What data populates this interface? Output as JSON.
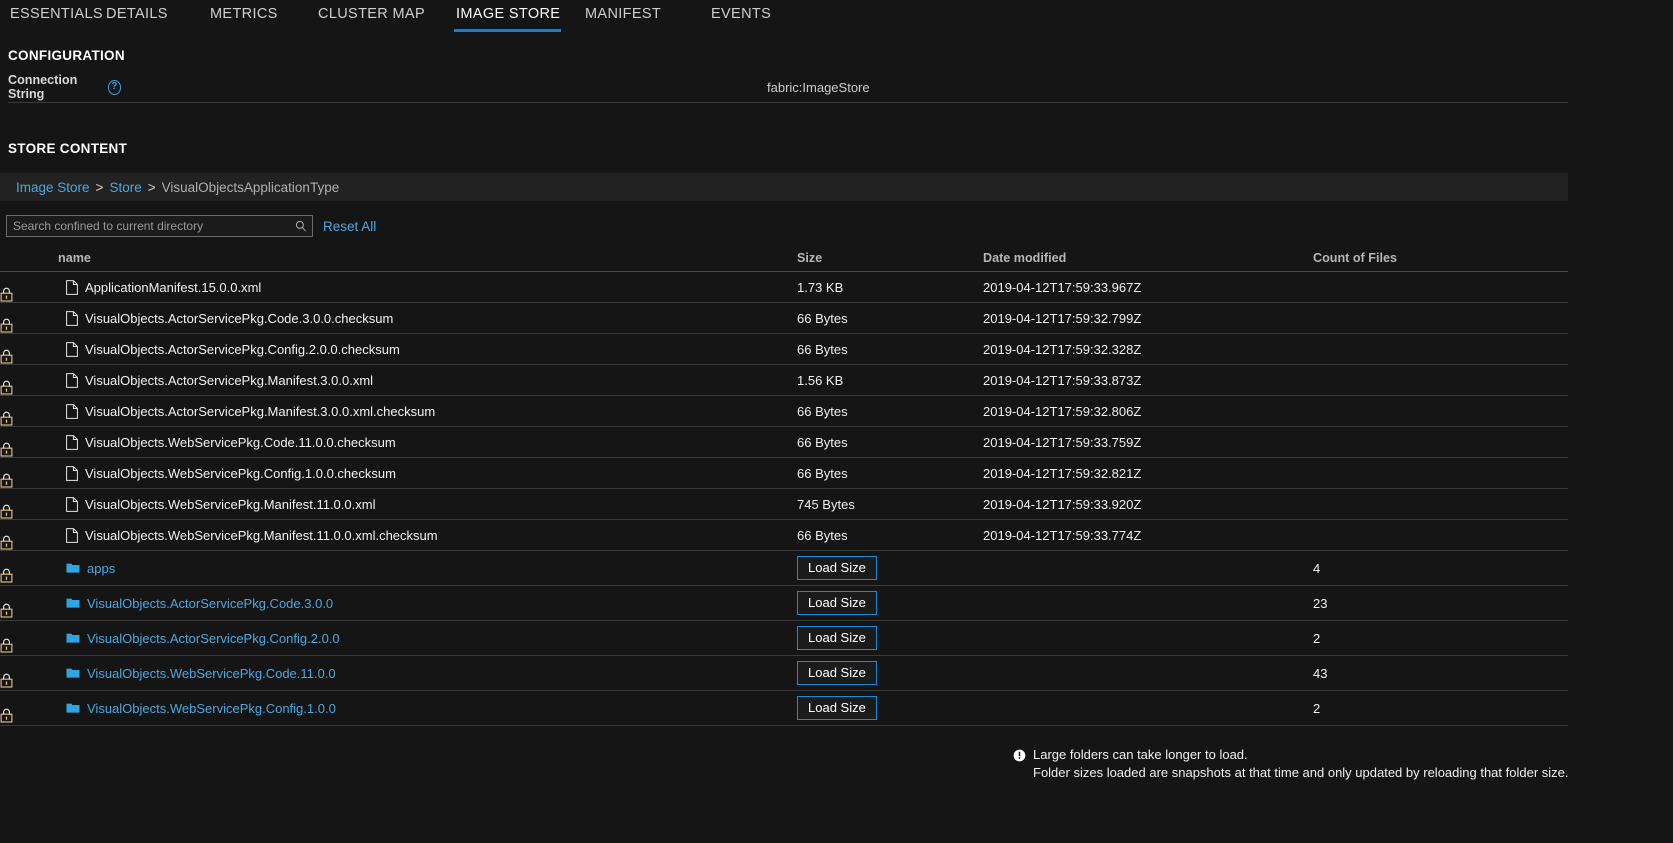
{
  "tabs": [
    {
      "label": "ESSENTIALS",
      "active": false
    },
    {
      "label": "DETAILS",
      "active": false
    },
    {
      "label": "METRICS",
      "active": false
    },
    {
      "label": "CLUSTER MAP",
      "active": false
    },
    {
      "label": "IMAGE STORE",
      "active": true
    },
    {
      "label": "MANIFEST",
      "active": false
    },
    {
      "label": "EVENTS",
      "active": false
    }
  ],
  "configuration": {
    "heading": "CONFIGURATION",
    "connection_string_label": "Connection String",
    "help_glyph": "?",
    "connection_string_value": "fabric:ImageStore"
  },
  "store_content": {
    "heading": "STORE CONTENT",
    "breadcrumb": [
      {
        "label": "Image Store",
        "link": true
      },
      {
        "label": ">",
        "link": false
      },
      {
        "label": "Store",
        "link": true
      },
      {
        "label": ">",
        "link": false
      },
      {
        "label": "VisualObjectsApplicationType",
        "link": false
      }
    ],
    "search_placeholder": "Search confined to current directory",
    "search_value": "",
    "reset_all_label": "Reset All",
    "columns": [
      "",
      "name",
      "Size",
      "Date modified",
      "Count of Files"
    ],
    "rows": [
      {
        "type": "file",
        "name": "ApplicationManifest.15.0.0.xml",
        "size": "1.73 KB",
        "date": "2019-04-12T17:59:33.967Z",
        "count": ""
      },
      {
        "type": "file",
        "name": "VisualObjects.ActorServicePkg.Code.3.0.0.checksum",
        "size": "66 Bytes",
        "date": "2019-04-12T17:59:32.799Z",
        "count": ""
      },
      {
        "type": "file",
        "name": "VisualObjects.ActorServicePkg.Config.2.0.0.checksum",
        "size": "66 Bytes",
        "date": "2019-04-12T17:59:32.328Z",
        "count": ""
      },
      {
        "type": "file",
        "name": "VisualObjects.ActorServicePkg.Manifest.3.0.0.xml",
        "size": "1.56 KB",
        "date": "2019-04-12T17:59:33.873Z",
        "count": ""
      },
      {
        "type": "file",
        "name": "VisualObjects.ActorServicePkg.Manifest.3.0.0.xml.checksum",
        "size": "66 Bytes",
        "date": "2019-04-12T17:59:32.806Z",
        "count": ""
      },
      {
        "type": "file",
        "name": "VisualObjects.WebServicePkg.Code.11.0.0.checksum",
        "size": "66 Bytes",
        "date": "2019-04-12T17:59:33.759Z",
        "count": ""
      },
      {
        "type": "file",
        "name": "VisualObjects.WebServicePkg.Config.1.0.0.checksum",
        "size": "66 Bytes",
        "date": "2019-04-12T17:59:32.821Z",
        "count": ""
      },
      {
        "type": "file",
        "name": "VisualObjects.WebServicePkg.Manifest.11.0.0.xml",
        "size": "745 Bytes",
        "date": "2019-04-12T17:59:33.920Z",
        "count": ""
      },
      {
        "type": "file",
        "name": "VisualObjects.WebServicePkg.Manifest.11.0.0.xml.checksum",
        "size": "66 Bytes",
        "date": "2019-04-12T17:59:33.774Z",
        "count": ""
      },
      {
        "type": "folder",
        "name": "apps",
        "size": "Load Size",
        "date": "",
        "count": "4"
      },
      {
        "type": "folder",
        "name": "VisualObjects.ActorServicePkg.Code.3.0.0",
        "size": "Load Size",
        "date": "",
        "count": "23"
      },
      {
        "type": "folder",
        "name": "VisualObjects.ActorServicePkg.Config.2.0.0",
        "size": "Load Size",
        "date": "",
        "count": "2"
      },
      {
        "type": "folder",
        "name": "VisualObjects.WebServicePkg.Code.11.0.0",
        "size": "Load Size",
        "date": "",
        "count": "43"
      },
      {
        "type": "folder",
        "name": "VisualObjects.WebServicePkg.Config.1.0.0",
        "size": "Load Size",
        "date": "",
        "count": "2"
      }
    ],
    "footer_note": [
      "Large folders can take longer to load.",
      "Folder sizes loaded are snapshots at that time and only updated by reloading that folder size."
    ]
  },
  "colors": {
    "accent": "#0a84d8",
    "link": "#4aa8e0",
    "background": "#151515",
    "row_border": "#3a3a3a",
    "breadcrumb_bg": "#222222"
  },
  "icons": {
    "lock": "lock-icon",
    "file": "file-icon",
    "folder": "folder-icon",
    "search": "search-icon",
    "help": "help-icon",
    "warning": "exclamation-circle-icon"
  }
}
